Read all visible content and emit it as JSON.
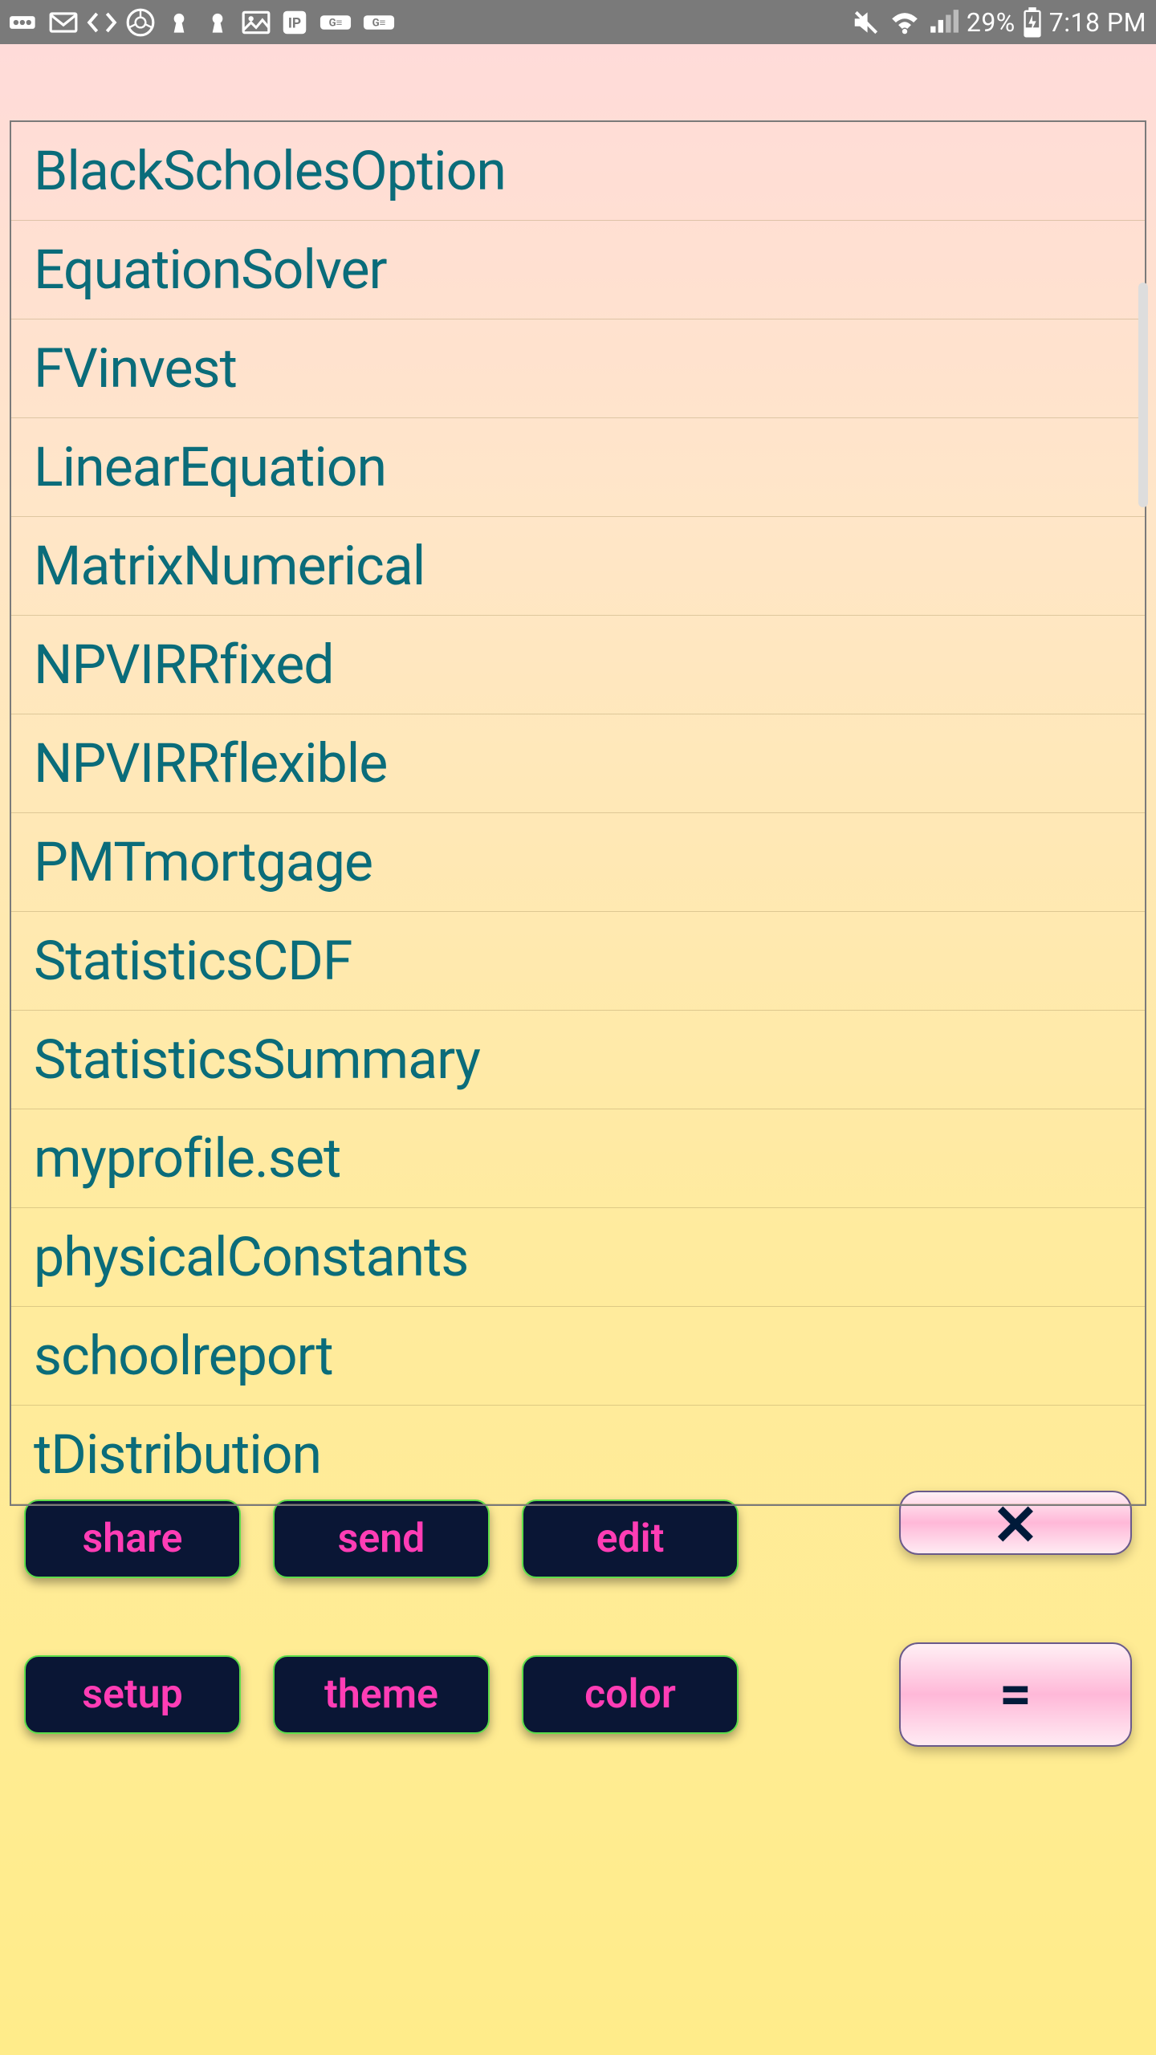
{
  "status": {
    "battery_pct": "29%",
    "time": "7:18 PM"
  },
  "list": {
    "items": [
      "BlackScholesOption",
      "EquationSolver",
      "FVinvest",
      "LinearEquation",
      "MatrixNumerical",
      "NPVIRRfixed",
      "NPVIRRflexible",
      "PMTmortgage",
      "StatisticsCDF",
      "StatisticsSummary",
      "myprofile.set",
      "physicalConstants",
      "schoolreport",
      "tDistribution"
    ]
  },
  "buttons": {
    "row1": {
      "share": "share",
      "send": "send",
      "edit": "edit"
    },
    "row2": {
      "setup": "setup",
      "theme": "theme",
      "color": "color"
    },
    "ops": {
      "multiply": "✕",
      "equals": "="
    }
  }
}
